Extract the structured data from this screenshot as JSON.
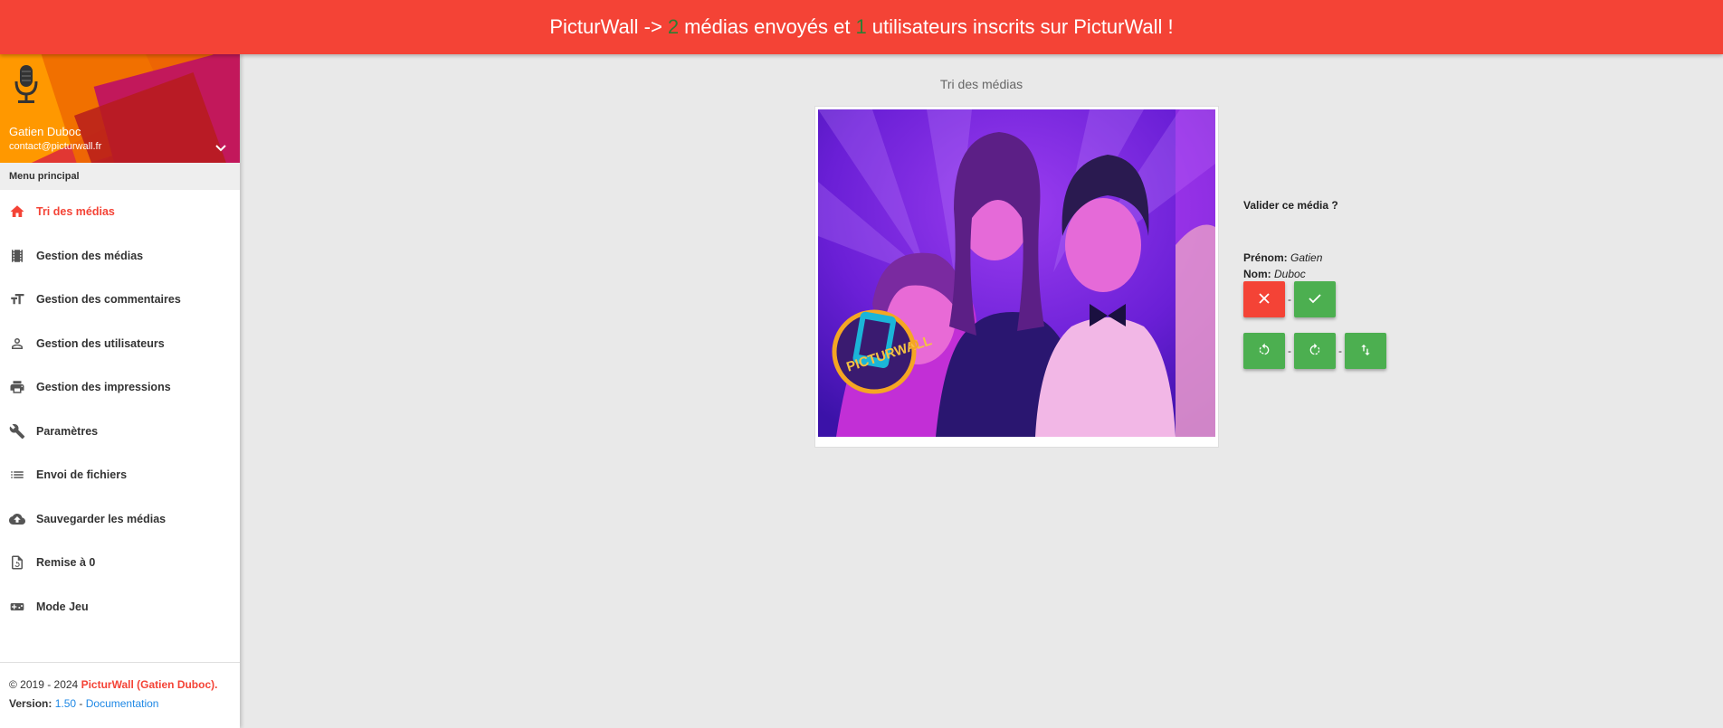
{
  "banner": {
    "part1": "PicturWall ->",
    "medias_count": "2",
    "part2": "médias envoyés et",
    "users_count": "1",
    "part3": "utilisateurs inscrits sur PicturWall !",
    "count_color": "#2e7d32"
  },
  "profile": {
    "name": "Gatien Duboc",
    "email": "contact@picturwall.fr"
  },
  "menu_header": "Menu principal",
  "menu": [
    {
      "label": "Tri des médias",
      "icon": "home-icon",
      "active": true
    },
    {
      "label": "Gestion des médias",
      "icon": "film-icon"
    },
    {
      "label": "Gestion des commentaires",
      "icon": "text-size-icon"
    },
    {
      "label": "Gestion des utilisateurs",
      "icon": "person-icon"
    },
    {
      "label": "Gestion des impressions",
      "icon": "printer-icon"
    },
    {
      "label": "Paramètres",
      "icon": "wrench-icon"
    },
    {
      "label": "Envoi de fichiers",
      "icon": "list-icon"
    },
    {
      "label": "Sauvegarder les médias",
      "icon": "cloud-upload-icon"
    },
    {
      "label": "Remise à 0",
      "icon": "restore-icon"
    },
    {
      "label": "Mode Jeu",
      "icon": "gamepad-icon"
    }
  ],
  "footer": {
    "copyright": "© 2019 - 2024",
    "brand": "PicturWall (Gatien Duboc).",
    "version_label": "Version:",
    "version": "1.50",
    "dash": "-",
    "doc_link": "Documentation"
  },
  "main": {
    "title": "Tri des médias",
    "question": "Valider ce média ?",
    "prenom_label": "Prénom:",
    "prenom": "Gatien",
    "nom_label": "Nom:",
    "nom": "Duboc",
    "separator": "-"
  },
  "colors": {
    "accent": "#f44336",
    "success": "#4caf50"
  }
}
